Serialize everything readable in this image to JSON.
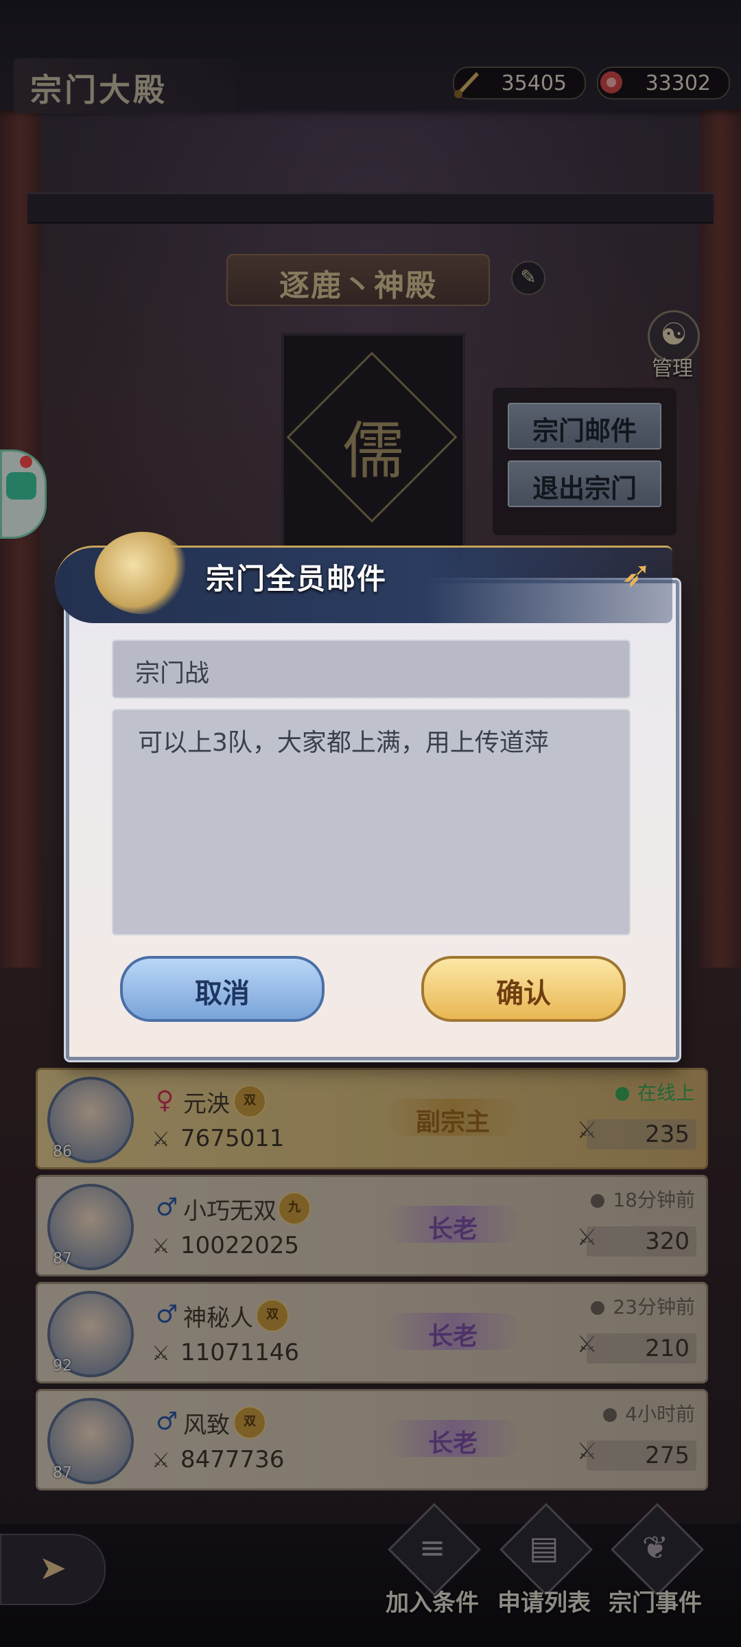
{
  "header": {
    "title": "宗门大殿",
    "currency_a": "35405",
    "currency_b": "33302"
  },
  "sect": {
    "name": "逐鹿丶神殿",
    "manage_label": "管理",
    "banner_glyph": "儒",
    "menu": [
      "宗门邮件",
      "退出宗门"
    ]
  },
  "dialog": {
    "title": "宗门全员邮件",
    "subject": "宗门战",
    "body": "可以上3队，大家都上满，用上传道萍",
    "cancel_label": "取消",
    "confirm_label": "确认"
  },
  "members": [
    {
      "level": "86",
      "gender": "♀",
      "name": "元泱",
      "tag": "",
      "power": "7675011",
      "rank": "副宗主",
      "status": "在线上",
      "contribution": "235"
    },
    {
      "level": "87",
      "gender": "♂",
      "name": "小巧无双",
      "tag": "",
      "power": "10022025",
      "rank": "长老",
      "status": "18分钟前",
      "contribution": "320"
    },
    {
      "level": "92",
      "gender": "♂",
      "name": "神秘人",
      "tag": "",
      "power": "11071146",
      "rank": "长老",
      "status": "23分钟前",
      "contribution": "210"
    },
    {
      "level": "87",
      "gender": "♂",
      "name": "风致",
      "tag": "",
      "power": "8477736",
      "rank": "长老",
      "status": "4小时前",
      "contribution": "275"
    }
  ],
  "bottom_nav": [
    "加入条件",
    "申请列表",
    "宗门事件"
  ],
  "colors": {
    "dialog_header": "#23314f",
    "confirm": "#e8b753",
    "cancel": "#7aa4d9",
    "online": "#3aa85b"
  }
}
